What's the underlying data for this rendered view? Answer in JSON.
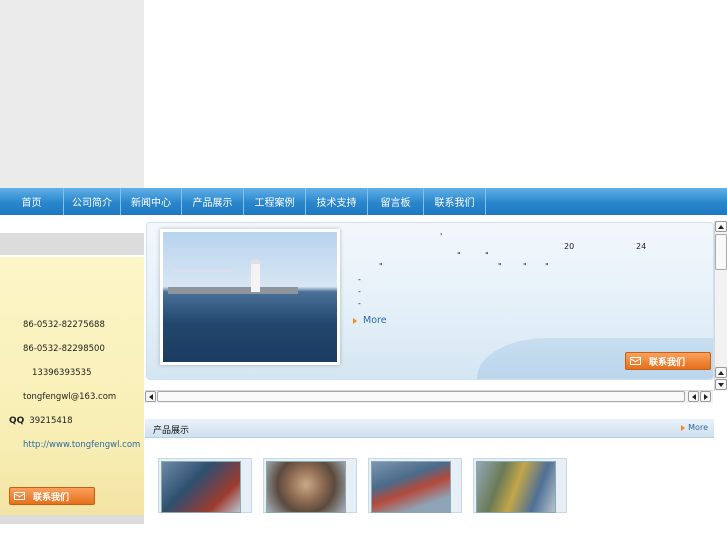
{
  "nav": {
    "items": [
      {
        "label": "首页"
      },
      {
        "label": "公司简介"
      },
      {
        "label": "新闻中心"
      },
      {
        "label": "产品展示"
      },
      {
        "label": "工程案例"
      },
      {
        "label": "技术支持"
      },
      {
        "label": "留言板"
      },
      {
        "label": "联系我们"
      }
    ]
  },
  "sidebar": {
    "phone1": "86-0532-82275688",
    "phone2": "86-0532-82298500",
    "mobile": "13396393535",
    "email": "tongfengwl@163.com",
    "qq_label": "QQ",
    "qq": "39215418",
    "website": "http://www.tongfengwl.com",
    "contact_button": "联系我们"
  },
  "about": {
    "text_fragments": [
      "'",
      "20",
      "24",
      "\"",
      "\"",
      "\"",
      "\"",
      "\"",
      "\"",
      "-",
      "-",
      "-"
    ],
    "more": "More",
    "contact_button": "联系我们"
  },
  "products": {
    "title": "产品展示",
    "more": "More"
  },
  "colors": {
    "nav_blue": "#2a86cc",
    "accent_orange": "#f08a24",
    "link_blue": "#2c6aa0",
    "sidebar_yellow": "#f8eeb4"
  }
}
